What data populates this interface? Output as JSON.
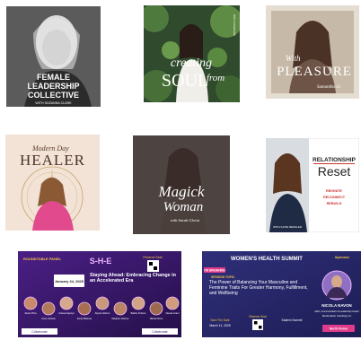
{
  "gallery": {
    "tiles": [
      {
        "title_line1": "FEMALE",
        "title_line2": "LEADERSHIP",
        "title_line3": "COLLECTIVE",
        "subtitle": "WITH SUZANNA CLARK"
      },
      {
        "title_line1": "creating",
        "title_line2": "SOUL",
        "title_line3": "from",
        "side_text": "WITH CAROLINE"
      },
      {
        "title_script": "With",
        "title_main": "PLEASURE",
        "signature": "Samantha Jo"
      },
      {
        "title_script": "Modern Day",
        "title_main": "HEALER"
      },
      {
        "title_line1": "Magick",
        "title_line2": "Woman",
        "signature": "with Sarah Gloria"
      },
      {
        "title_line1": "RELATIONSHIP",
        "title_line2": "Reset",
        "steps": [
          "REIGNITE",
          "RECONNECT",
          "REBUILD"
        ],
        "host": "WITH KATIE RESSLER"
      },
      {
        "tag": "ROUNDTABLE PANEL",
        "logo": "S-H-E",
        "date": "January 24, 2025",
        "headline": "Staying Ahead: Embracing Change in an Accelerated Era",
        "reserve": "Reserve Seat",
        "footer_left": "Collaborate",
        "footer_right": "Collaborate",
        "speakers": [
          "Jamie Price",
          "Anne Carlson",
          "Ariana Kapwyn",
          "Emily Bellows",
          "Alyssa Warren",
          "Meghan Gisbury",
          "Barbie Finlone",
          "Nikola Nixon",
          "Danaa Grant"
        ]
      },
      {
        "tag": "I'M SPEAKING",
        "title": "WOMEN'S HEALTH SUMMIT",
        "sponsor_label": "Sponsor",
        "session_label": "SESSION TOPIC",
        "session": "The Power of Balancing Your Masculine and Feminine Traits For Greater Harmony, Fulfillment, and Wellbeing",
        "save_date": "Save The Date",
        "date": "March 11, 2025",
        "reserve": "Reserve Seat",
        "time_label": "Eastern Summit",
        "speaker_name": "NICOLA NAVON",
        "speaker_role": "CEO, Communication & Leadership Coach",
        "speaker_company": "Nicola Navon Coaching LLC",
        "org": "North Penno"
      }
    ]
  },
  "colors": {
    "t1_bg": "#5a5a5a",
    "t3_bg": "#e4ddd2",
    "t4_bg": "#f2e3d6",
    "t5_bg": "#5e5552",
    "t7_bg": "#3b1a6b",
    "t8_bg": "#2a2a6e",
    "accent_pink": "#e13a8a",
    "accent_red": "#c9302c",
    "gold": "#b8873b"
  }
}
